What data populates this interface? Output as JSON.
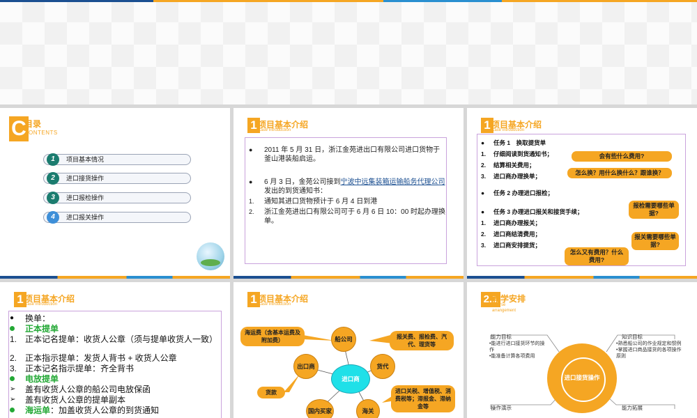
{
  "slide1": {
    "c_letter": "C",
    "title": "目录",
    "subtitle": "ONTENTS",
    "toc": [
      {
        "num": "1",
        "label": "项目基本情况"
      },
      {
        "num": "2",
        "label": "进口接货操作"
      },
      {
        "num": "3",
        "label": "进口报检操作"
      },
      {
        "num": "4",
        "label": "进口报关操作"
      }
    ]
  },
  "slide2": {
    "num": "1",
    "title": "项目基本介绍",
    "subtitle": "Case Introduction",
    "bullet": "●",
    "p1": "2011 年 5 月 31 日，浙江金苑进出口有限公司进口货物于釜山港装船启运。",
    "p2_pre": "6 月 3 日，金苑公司接到",
    "p2_link": "宁波中远集装箱运输船务代理公司",
    "p2_post": "发出的到货通知书：",
    "items": [
      {
        "n": "1.",
        "text": "通知其进口货物预计于 6 月 4 日到港"
      },
      {
        "n": "2.",
        "text": "浙江金苑进出口有限公司可于 6 月 6 日 10：00 时起办理换单。"
      }
    ]
  },
  "slide3": {
    "num": "1",
    "title": "项目基本介绍",
    "subtitle": "Case Introduction",
    "bullet": "●",
    "task1": "任务 1　换取提货单",
    "task1_items": [
      {
        "n": "1.",
        "text": "仔细阅读到货通知书；"
      },
      {
        "n": "2.",
        "text": "结算相关费用；"
      },
      {
        "n": "3.",
        "text": "进口商办理换单；"
      }
    ],
    "task2": "任务 2  办理进口报检；",
    "task3": "任务 3  办理进口报关和接货手续；",
    "task3_items": [
      {
        "n": "1.",
        "text": "进口商办理报关；"
      },
      {
        "n": "2.",
        "text": "进口商结清费用；"
      },
      {
        "n": "3.",
        "text": "进口商安排提货；"
      }
    ],
    "callouts": {
      "c1": "会有些什么费用?",
      "c2": "怎么换？用什么换什么？跟谁换？",
      "c3": "报检需要哪些单据?",
      "c4": "报关需要哪些单据?",
      "c5": "怎么又有费用？什么费用?"
    }
  },
  "slide4": {
    "num": "1",
    "title": "项目基本介绍",
    "subtitle": "Case Introduction",
    "bullet": "●",
    "arrow": "➢",
    "intro": "换单：",
    "h1": "正本提单",
    "items1": [
      {
        "n": "1.",
        "text": "正本记名提单：收货人公章（须与提单收货人一致）"
      },
      {
        "n": "2.",
        "text": "正本指示提单：发货人背书 + 收货人公章"
      },
      {
        "n": "3.",
        "text": "正本记名指示提单：齐全背书"
      }
    ],
    "h2": "电放提单",
    "items2": [
      "盖有收货人公章的船公司电放保函",
      "盖有收货人公章的提单副本"
    ],
    "h3": "海运单",
    "h3_text": "：加盖收货人公章的到货通知"
  },
  "slide5": {
    "num": "1",
    "title": "项目基本介绍",
    "subtitle": "Case Introduction",
    "center": "进口商",
    "nodes": {
      "ship": "船公司",
      "forwarder": "货代",
      "importer": "出口商",
      "customs": "海关",
      "buyer": "国内买家"
    },
    "bubbles": {
      "freight": "海运费（含基本运费及附加费）",
      "fees": "报关费、报检费、汽代、理货等",
      "taxes": "进口关税、增值税、消费税等；滞报金、滞纳金等",
      "payment": "货款"
    }
  },
  "slide6": {
    "num": "2.1",
    "title": "教学安排",
    "subtitle": "Course arrangement",
    "center": "进口接货操作",
    "q1_head": "能力目标",
    "q1_body": "•能进行进口接货环节的操作\n•能准备计算各项费用",
    "q2_head": "知识目标",
    "q2_body": "•熟悉船公司的作业规定和惯例\n•掌握进口商品接货的各项操作原则",
    "q3_head": "操作演示",
    "q4_head": "能力拓展"
  }
}
